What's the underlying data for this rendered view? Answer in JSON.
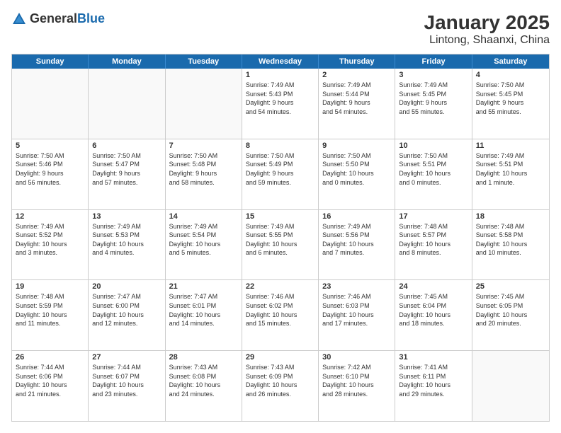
{
  "header": {
    "logo_general": "General",
    "logo_blue": "Blue",
    "title": "January 2025",
    "subtitle": "Lintong, Shaanxi, China"
  },
  "weekdays": [
    "Sunday",
    "Monday",
    "Tuesday",
    "Wednesday",
    "Thursday",
    "Friday",
    "Saturday"
  ],
  "rows": [
    [
      {
        "day": "",
        "lines": []
      },
      {
        "day": "",
        "lines": []
      },
      {
        "day": "",
        "lines": []
      },
      {
        "day": "1",
        "lines": [
          "Sunrise: 7:49 AM",
          "Sunset: 5:43 PM",
          "Daylight: 9 hours",
          "and 54 minutes."
        ]
      },
      {
        "day": "2",
        "lines": [
          "Sunrise: 7:49 AM",
          "Sunset: 5:44 PM",
          "Daylight: 9 hours",
          "and 54 minutes."
        ]
      },
      {
        "day": "3",
        "lines": [
          "Sunrise: 7:49 AM",
          "Sunset: 5:45 PM",
          "Daylight: 9 hours",
          "and 55 minutes."
        ]
      },
      {
        "day": "4",
        "lines": [
          "Sunrise: 7:50 AM",
          "Sunset: 5:45 PM",
          "Daylight: 9 hours",
          "and 55 minutes."
        ]
      }
    ],
    [
      {
        "day": "5",
        "lines": [
          "Sunrise: 7:50 AM",
          "Sunset: 5:46 PM",
          "Daylight: 9 hours",
          "and 56 minutes."
        ]
      },
      {
        "day": "6",
        "lines": [
          "Sunrise: 7:50 AM",
          "Sunset: 5:47 PM",
          "Daylight: 9 hours",
          "and 57 minutes."
        ]
      },
      {
        "day": "7",
        "lines": [
          "Sunrise: 7:50 AM",
          "Sunset: 5:48 PM",
          "Daylight: 9 hours",
          "and 58 minutes."
        ]
      },
      {
        "day": "8",
        "lines": [
          "Sunrise: 7:50 AM",
          "Sunset: 5:49 PM",
          "Daylight: 9 hours",
          "and 59 minutes."
        ]
      },
      {
        "day": "9",
        "lines": [
          "Sunrise: 7:50 AM",
          "Sunset: 5:50 PM",
          "Daylight: 10 hours",
          "and 0 minutes."
        ]
      },
      {
        "day": "10",
        "lines": [
          "Sunrise: 7:50 AM",
          "Sunset: 5:51 PM",
          "Daylight: 10 hours",
          "and 0 minutes."
        ]
      },
      {
        "day": "11",
        "lines": [
          "Sunrise: 7:49 AM",
          "Sunset: 5:51 PM",
          "Daylight: 10 hours",
          "and 1 minute."
        ]
      }
    ],
    [
      {
        "day": "12",
        "lines": [
          "Sunrise: 7:49 AM",
          "Sunset: 5:52 PM",
          "Daylight: 10 hours",
          "and 3 minutes."
        ]
      },
      {
        "day": "13",
        "lines": [
          "Sunrise: 7:49 AM",
          "Sunset: 5:53 PM",
          "Daylight: 10 hours",
          "and 4 minutes."
        ]
      },
      {
        "day": "14",
        "lines": [
          "Sunrise: 7:49 AM",
          "Sunset: 5:54 PM",
          "Daylight: 10 hours",
          "and 5 minutes."
        ]
      },
      {
        "day": "15",
        "lines": [
          "Sunrise: 7:49 AM",
          "Sunset: 5:55 PM",
          "Daylight: 10 hours",
          "and 6 minutes."
        ]
      },
      {
        "day": "16",
        "lines": [
          "Sunrise: 7:49 AM",
          "Sunset: 5:56 PM",
          "Daylight: 10 hours",
          "and 7 minutes."
        ]
      },
      {
        "day": "17",
        "lines": [
          "Sunrise: 7:48 AM",
          "Sunset: 5:57 PM",
          "Daylight: 10 hours",
          "and 8 minutes."
        ]
      },
      {
        "day": "18",
        "lines": [
          "Sunrise: 7:48 AM",
          "Sunset: 5:58 PM",
          "Daylight: 10 hours",
          "and 10 minutes."
        ]
      }
    ],
    [
      {
        "day": "19",
        "lines": [
          "Sunrise: 7:48 AM",
          "Sunset: 5:59 PM",
          "Daylight: 10 hours",
          "and 11 minutes."
        ]
      },
      {
        "day": "20",
        "lines": [
          "Sunrise: 7:47 AM",
          "Sunset: 6:00 PM",
          "Daylight: 10 hours",
          "and 12 minutes."
        ]
      },
      {
        "day": "21",
        "lines": [
          "Sunrise: 7:47 AM",
          "Sunset: 6:01 PM",
          "Daylight: 10 hours",
          "and 14 minutes."
        ]
      },
      {
        "day": "22",
        "lines": [
          "Sunrise: 7:46 AM",
          "Sunset: 6:02 PM",
          "Daylight: 10 hours",
          "and 15 minutes."
        ]
      },
      {
        "day": "23",
        "lines": [
          "Sunrise: 7:46 AM",
          "Sunset: 6:03 PM",
          "Daylight: 10 hours",
          "and 17 minutes."
        ]
      },
      {
        "day": "24",
        "lines": [
          "Sunrise: 7:45 AM",
          "Sunset: 6:04 PM",
          "Daylight: 10 hours",
          "and 18 minutes."
        ]
      },
      {
        "day": "25",
        "lines": [
          "Sunrise: 7:45 AM",
          "Sunset: 6:05 PM",
          "Daylight: 10 hours",
          "and 20 minutes."
        ]
      }
    ],
    [
      {
        "day": "26",
        "lines": [
          "Sunrise: 7:44 AM",
          "Sunset: 6:06 PM",
          "Daylight: 10 hours",
          "and 21 minutes."
        ]
      },
      {
        "day": "27",
        "lines": [
          "Sunrise: 7:44 AM",
          "Sunset: 6:07 PM",
          "Daylight: 10 hours",
          "and 23 minutes."
        ]
      },
      {
        "day": "28",
        "lines": [
          "Sunrise: 7:43 AM",
          "Sunset: 6:08 PM",
          "Daylight: 10 hours",
          "and 24 minutes."
        ]
      },
      {
        "day": "29",
        "lines": [
          "Sunrise: 7:43 AM",
          "Sunset: 6:09 PM",
          "Daylight: 10 hours",
          "and 26 minutes."
        ]
      },
      {
        "day": "30",
        "lines": [
          "Sunrise: 7:42 AM",
          "Sunset: 6:10 PM",
          "Daylight: 10 hours",
          "and 28 minutes."
        ]
      },
      {
        "day": "31",
        "lines": [
          "Sunrise: 7:41 AM",
          "Sunset: 6:11 PM",
          "Daylight: 10 hours",
          "and 29 minutes."
        ]
      },
      {
        "day": "",
        "lines": []
      }
    ]
  ]
}
